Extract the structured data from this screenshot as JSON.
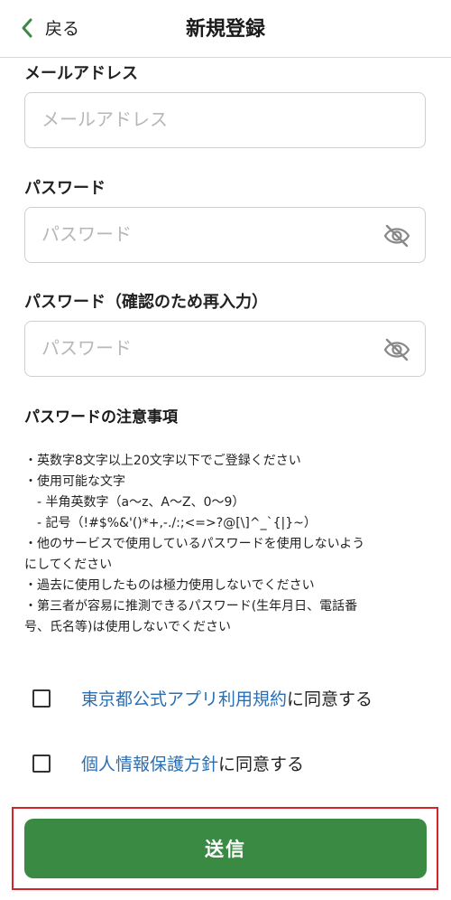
{
  "header": {
    "back_label": "戻る",
    "title": "新規登録"
  },
  "form": {
    "email": {
      "label": "メールアドレス",
      "placeholder": "メールアドレス"
    },
    "password": {
      "label": "パスワード",
      "placeholder": "パスワード"
    },
    "password_confirm": {
      "label": "パスワード（確認のため再入力）",
      "placeholder": "パスワード"
    }
  },
  "notes": {
    "title": "パスワードの注意事項",
    "lines": [
      "・英数字8文字以上20文字以下でご登録ください",
      "・使用可能な文字",
      "　- 半角英数字（a〜z、A〜Z、0〜9）",
      "　- 記号（!#$%&'()*+,-./:;<=>?@[\\]^_`{|}~）",
      "・他のサービスで使用しているパスワードを使用しないよう",
      "にしてください",
      "・過去に使用したものは極力使用しないでください",
      "・第三者が容易に推測できるパスワード(生年月日、電話番",
      "号、氏名等)は使用しないでください"
    ]
  },
  "agreements": {
    "terms": {
      "link": "東京都公式アプリ利用規約",
      "suffix": "に同意する"
    },
    "privacy": {
      "link": "個人情報保護方針",
      "suffix": "に同意する"
    }
  },
  "submit_label": "送信",
  "colors": {
    "primary": "#3b8a44",
    "link": "#2a6fb4",
    "highlight": "#d4232a"
  },
  "icons": {
    "back": "chevron-left-icon",
    "eye": "eye-off-icon"
  }
}
